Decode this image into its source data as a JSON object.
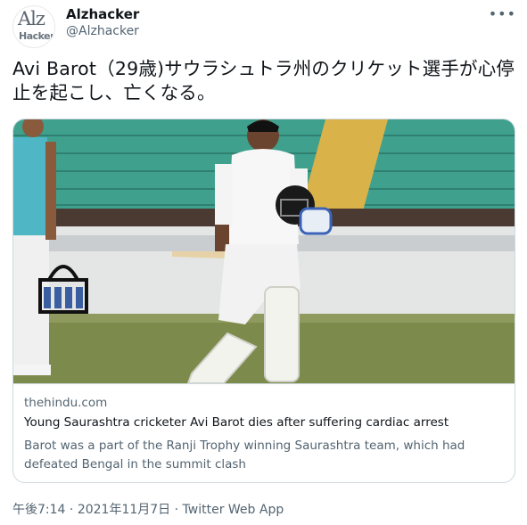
{
  "author": {
    "display_name": "Alzhacker",
    "handle": "@Alzhacker",
    "avatar_text_top": "Alz",
    "avatar_text_bottom": "Hacker"
  },
  "tweet": {
    "text": "Avi Barot（29歳)サウラシュトラ州のクリケット選手が心停止を起こし、亡くなる。"
  },
  "card": {
    "domain": "thehindu.com",
    "title": "Young Saurashtra cricketer Avi Barot dies after suffering cardiac arrest",
    "description": "Barot was a part of the Ranji Trophy winning Saurashtra team, which had defeated Bengal in the summit clash"
  },
  "footer": {
    "time": "午後7:14",
    "separator": " · ",
    "date": "2021年11月7日",
    "source": "Twitter Web App"
  },
  "icons": {
    "more": "more-horizontal-icon"
  },
  "colors": {
    "text_primary": "#0f1419",
    "text_secondary": "#536471",
    "border": "#cfd9de",
    "stadium_seats": "#3aa08c",
    "pitch_grass": "#7a8a4a"
  }
}
